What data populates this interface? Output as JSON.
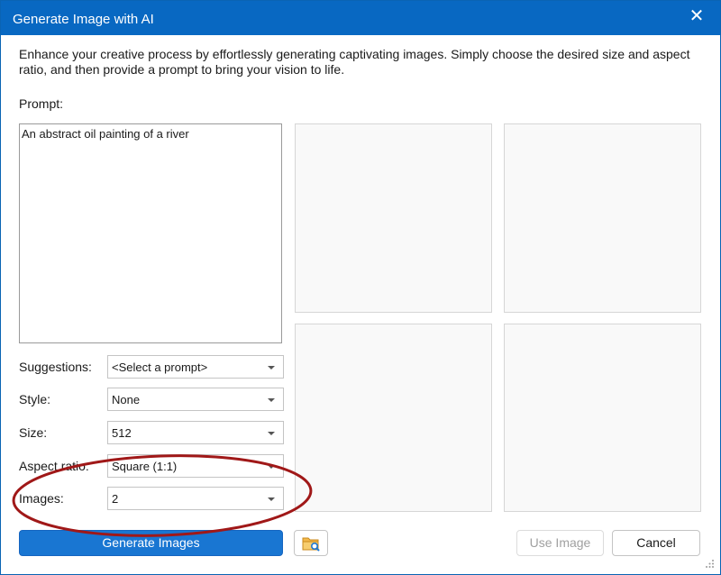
{
  "window": {
    "title": "Generate Image with AI",
    "close_glyph": "✕",
    "close_icon": "close-icon"
  },
  "description": "Enhance your creative process by effortlessly generating captivating images. Simply choose the desired size and aspect ratio, and then provide a prompt to bring your vision to life.",
  "prompt": {
    "label": "Prompt:",
    "value": "An abstract oil painting of a river"
  },
  "fields": {
    "suggestions": {
      "label": "Suggestions:",
      "value": "<Select a prompt>"
    },
    "style": {
      "label": "Style:",
      "value": "None"
    },
    "size": {
      "label": "Size:",
      "value": "512"
    },
    "aspect_ratio": {
      "label": "Aspect ratio:",
      "value": "Square (1:1)"
    },
    "images": {
      "label": "Images:",
      "value": "2"
    }
  },
  "buttons": {
    "generate": "Generate Images",
    "browse_icon": "folder-search-icon",
    "use_image": "Use Image",
    "cancel": "Cancel"
  },
  "colors": {
    "titlebar": "#0868c2",
    "primary_button": "#1976d2",
    "annotation_ellipse": "#a01818"
  }
}
